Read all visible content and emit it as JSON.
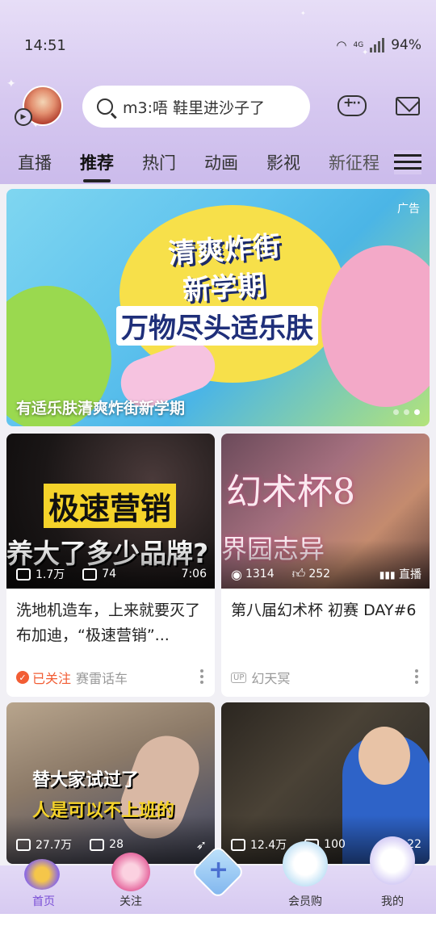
{
  "status": {
    "time": "14:51",
    "network": "4G",
    "battery": "94%"
  },
  "header": {
    "search_placeholder": "m3:唔 鞋里进沙子了"
  },
  "tabs": [
    {
      "label": "直播",
      "active": false
    },
    {
      "label": "推荐",
      "active": true
    },
    {
      "label": "热门",
      "active": false
    },
    {
      "label": "动画",
      "active": false
    },
    {
      "label": "影视",
      "active": false
    },
    {
      "label": "新征程",
      "active": false
    }
  ],
  "banner": {
    "ad_tag": "广告",
    "headline_1": "清爽炸街",
    "headline_2": "新学期",
    "headline_3": "万物尽头适乐肤",
    "caption": "有适乐肤清爽炸街新学期",
    "dots": 3,
    "active_dot": 3
  },
  "cards": [
    {
      "thumb_text_1": "极速营销",
      "thumb_text_2": "养大了多少品牌?",
      "views": "1.7万",
      "danmaku": "74",
      "duration": "7:06",
      "title": "洗地机造车，上来就要灭了布加迪，“极速营销”...",
      "followed_label": "已关注",
      "author": "赛雷话车"
    },
    {
      "thumb_text_1": "幻术杯8",
      "thumb_text_2": "界园志异",
      "views": "1314",
      "likes": "252",
      "live_label": "直播",
      "title": "第八届幻术杯 初赛 DAY#6",
      "up_badge": "UP",
      "author": "幻天冥"
    },
    {
      "thumb_text_1": "替大家试过了",
      "thumb_text_2": "人是可以不上班的",
      "views": "27.7万",
      "danmaku": "28"
    },
    {
      "views": "12.4万",
      "danmaku": "100",
      "duration": "22"
    }
  ],
  "bottom_nav": [
    {
      "label": "首页",
      "active": true,
      "icon": "home-icon"
    },
    {
      "label": "关注",
      "active": false,
      "icon": "follow-icon"
    },
    {
      "label": "",
      "active": false,
      "icon": "publish-icon"
    },
    {
      "label": "会员购",
      "active": false,
      "icon": "shop-icon"
    },
    {
      "label": "我的",
      "active": false,
      "icon": "profile-icon"
    }
  ],
  "colors": {
    "accent": "#f25d34",
    "nav_active": "#7a4fd6",
    "header_bg": "#d6c8f0"
  }
}
